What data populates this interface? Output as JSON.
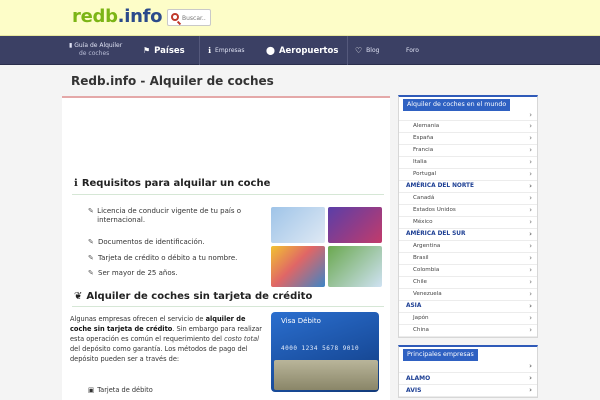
{
  "header": {
    "logo_main": "redb",
    "logo_dot": ".info",
    "search_placeholder": "Buscar.."
  },
  "nav": {
    "guia_line1": "Guía de Alquiler",
    "guia_line2": "de coches",
    "paises": "Países",
    "empresas": "Empresas",
    "aeropuertos": "Aeropuertos",
    "blog": "Blog",
    "foro": "Foro"
  },
  "page": {
    "title": "Redb.info - Alquiler de coches"
  },
  "requisitos": {
    "title": "Requisitos para alquilar un coche",
    "items": [
      "Licencia de conducir vigente de tu país o internacional.",
      "Documentos de identificación.",
      "Tarjeta de crédito o débito a tu nombre.",
      "Ser mayor de 25 años."
    ]
  },
  "sin_tarjeta": {
    "title": "Alquiler de coches sin tarjeta de crédito",
    "p1": "Algunas empresas ofrecen el servicio de",
    "p2_bold": "alquiler de coche sin tarjeta de crédito",
    "p2_rest": ". Sin embargo para realizar esta operación es común el requerimiento del",
    "p3_em": "costo total",
    "p3_rest": " del depósito como garantía. Los métodos de pago del depósito pueden ser a través de:",
    "debit_label": "Visa Débito",
    "debit_number": "4000 1234 5678 9010",
    "method_1": "Tarjeta de débito"
  },
  "sidebar": {
    "world_title": "Alquiler de coches en el mundo",
    "world_rows": [
      {
        "label": "",
        "type": "first"
      },
      {
        "label": "Alemania",
        "type": "country"
      },
      {
        "label": "España",
        "type": "country"
      },
      {
        "label": "Francia",
        "type": "country"
      },
      {
        "label": "Italia",
        "type": "country"
      },
      {
        "label": "Portugal",
        "type": "country"
      },
      {
        "label": "AMÉRICA DEL NORTE",
        "type": "region"
      },
      {
        "label": "Canadá",
        "type": "country"
      },
      {
        "label": "Estados Unidos",
        "type": "country"
      },
      {
        "label": "México",
        "type": "country"
      },
      {
        "label": "AMÉRICA DEL SUR",
        "type": "region"
      },
      {
        "label": "Argentina",
        "type": "country"
      },
      {
        "label": "Brasil",
        "type": "country"
      },
      {
        "label": "Colombia",
        "type": "country"
      },
      {
        "label": "Chile",
        "type": "country"
      },
      {
        "label": "Venezuela",
        "type": "country"
      },
      {
        "label": "ASIA",
        "type": "region"
      },
      {
        "label": "Japón",
        "type": "country"
      },
      {
        "label": "China",
        "type": "country"
      }
    ],
    "companies_title": "Principales empresas",
    "companies": [
      "",
      "ALAMO",
      "AVIS"
    ]
  },
  "colors": {
    "nav_bg": "#3b4064",
    "logo_green": "#7cb516",
    "accent_blue": "#2f61c2",
    "header_bg": "#fdfdc8"
  }
}
